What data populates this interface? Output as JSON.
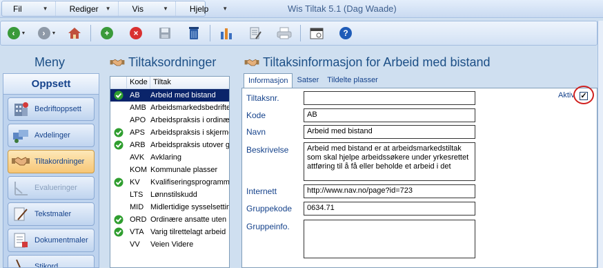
{
  "menubar": {
    "items": [
      {
        "label": "Fil"
      },
      {
        "label": "Rediger"
      },
      {
        "label": "Vis"
      },
      {
        "label": "Hjelp"
      }
    ]
  },
  "app_title": "Wis Tiltak 5.1 (Dag Waade)",
  "toolbar": {
    "buttons": [
      "back-icon",
      "forward-icon",
      "home-icon",
      "add-icon",
      "delete-icon",
      "save-icon",
      "trash-icon",
      "report-icon",
      "document-icon",
      "print-icon",
      "calendar-icon",
      "help-icon"
    ]
  },
  "sidebar": {
    "title": "Meny",
    "section": "Oppsett",
    "items": [
      {
        "label": "Bedriftoppsett",
        "icon": "building-icon"
      },
      {
        "label": "Avdelinger",
        "icon": "departments-icon"
      },
      {
        "label": "Tiltakordninger",
        "icon": "handshake-icon"
      },
      {
        "label": "Evalueringer",
        "icon": "evaluation-icon"
      },
      {
        "label": "Tekstmaler",
        "icon": "text-template-icon"
      },
      {
        "label": "Dokumentmaler",
        "icon": "document-template-icon"
      },
      {
        "label": "Stikord",
        "icon": "keyword-icon"
      }
    ]
  },
  "list": {
    "title": "Tiltaksordninger",
    "columns": [
      "Kode",
      "Tiltak"
    ],
    "rows": [
      {
        "kode": "AB",
        "tiltak": "Arbeid med bistand",
        "checked": true,
        "selected": true
      },
      {
        "kode": "AMB",
        "tiltak": "Arbeidsmarkedsbedrifter",
        "checked": false,
        "selected": false
      },
      {
        "kode": "APO",
        "tiltak": "Arbeidspraksis i ordinær",
        "checked": false,
        "selected": false
      },
      {
        "kode": "APS",
        "tiltak": "Arbeidspraksis i skjermet",
        "checked": true,
        "selected": false
      },
      {
        "kode": "ARB",
        "tiltak": "Arbeidspraksis utover g",
        "checked": true,
        "selected": false
      },
      {
        "kode": "AVK",
        "tiltak": "Avklaring",
        "checked": false,
        "selected": false
      },
      {
        "kode": "KOM",
        "tiltak": "Kommunale plasser",
        "checked": false,
        "selected": false
      },
      {
        "kode": "KV",
        "tiltak": "Kvalifiseringsprogramm",
        "checked": true,
        "selected": false
      },
      {
        "kode": "LTS",
        "tiltak": "Lønnstilskudd",
        "checked": false,
        "selected": false
      },
      {
        "kode": "MID",
        "tiltak": "Midlertidige sysselsettin",
        "checked": false,
        "selected": false
      },
      {
        "kode": "ORD",
        "tiltak": "Ordinære ansatte uten",
        "checked": true,
        "selected": false
      },
      {
        "kode": "VTA",
        "tiltak": "Varig tilrettelagt arbeid",
        "checked": true,
        "selected": false
      },
      {
        "kode": "VV",
        "tiltak": "Veien Videre",
        "checked": false,
        "selected": false
      }
    ]
  },
  "info": {
    "title": "Tiltaksinformasjon for Arbeid med bistand",
    "tabs": [
      "Informasjon",
      "Satser",
      "Tildelte plasser"
    ],
    "aktiv_label": "Aktiv",
    "aktiv_checked": true,
    "fields": {
      "tiltaksnr_label": "Tiltaksnr.",
      "tiltaksnr_value": "",
      "kode_label": "Kode",
      "kode_value": "AB",
      "navn_label": "Navn",
      "navn_value": "Arbeid med bistand",
      "beskrivelse_label": "Beskrivelse",
      "beskrivelse_value": "Arbeid med bistand er at arbeidsmarkedstiltak som skal hjelpe arbeidssøkere under yrkesrettet attføring til å få eller beholde et arbeid i det",
      "internett_label": "Internett",
      "internett_value": "http://www.nav.no/page?id=723",
      "gruppekode_label": "Gruppekode",
      "gruppekode_value": "0634.71",
      "gruppeinfo_label": "Gruppeinfo.",
      "gruppeinfo_value": ""
    }
  },
  "colors": {
    "accent": "#15428b",
    "selection": "#0a246a",
    "active_menu": "#f7c676",
    "check_green": "#2f9e2f",
    "highlight_ring": "#d0211f"
  }
}
